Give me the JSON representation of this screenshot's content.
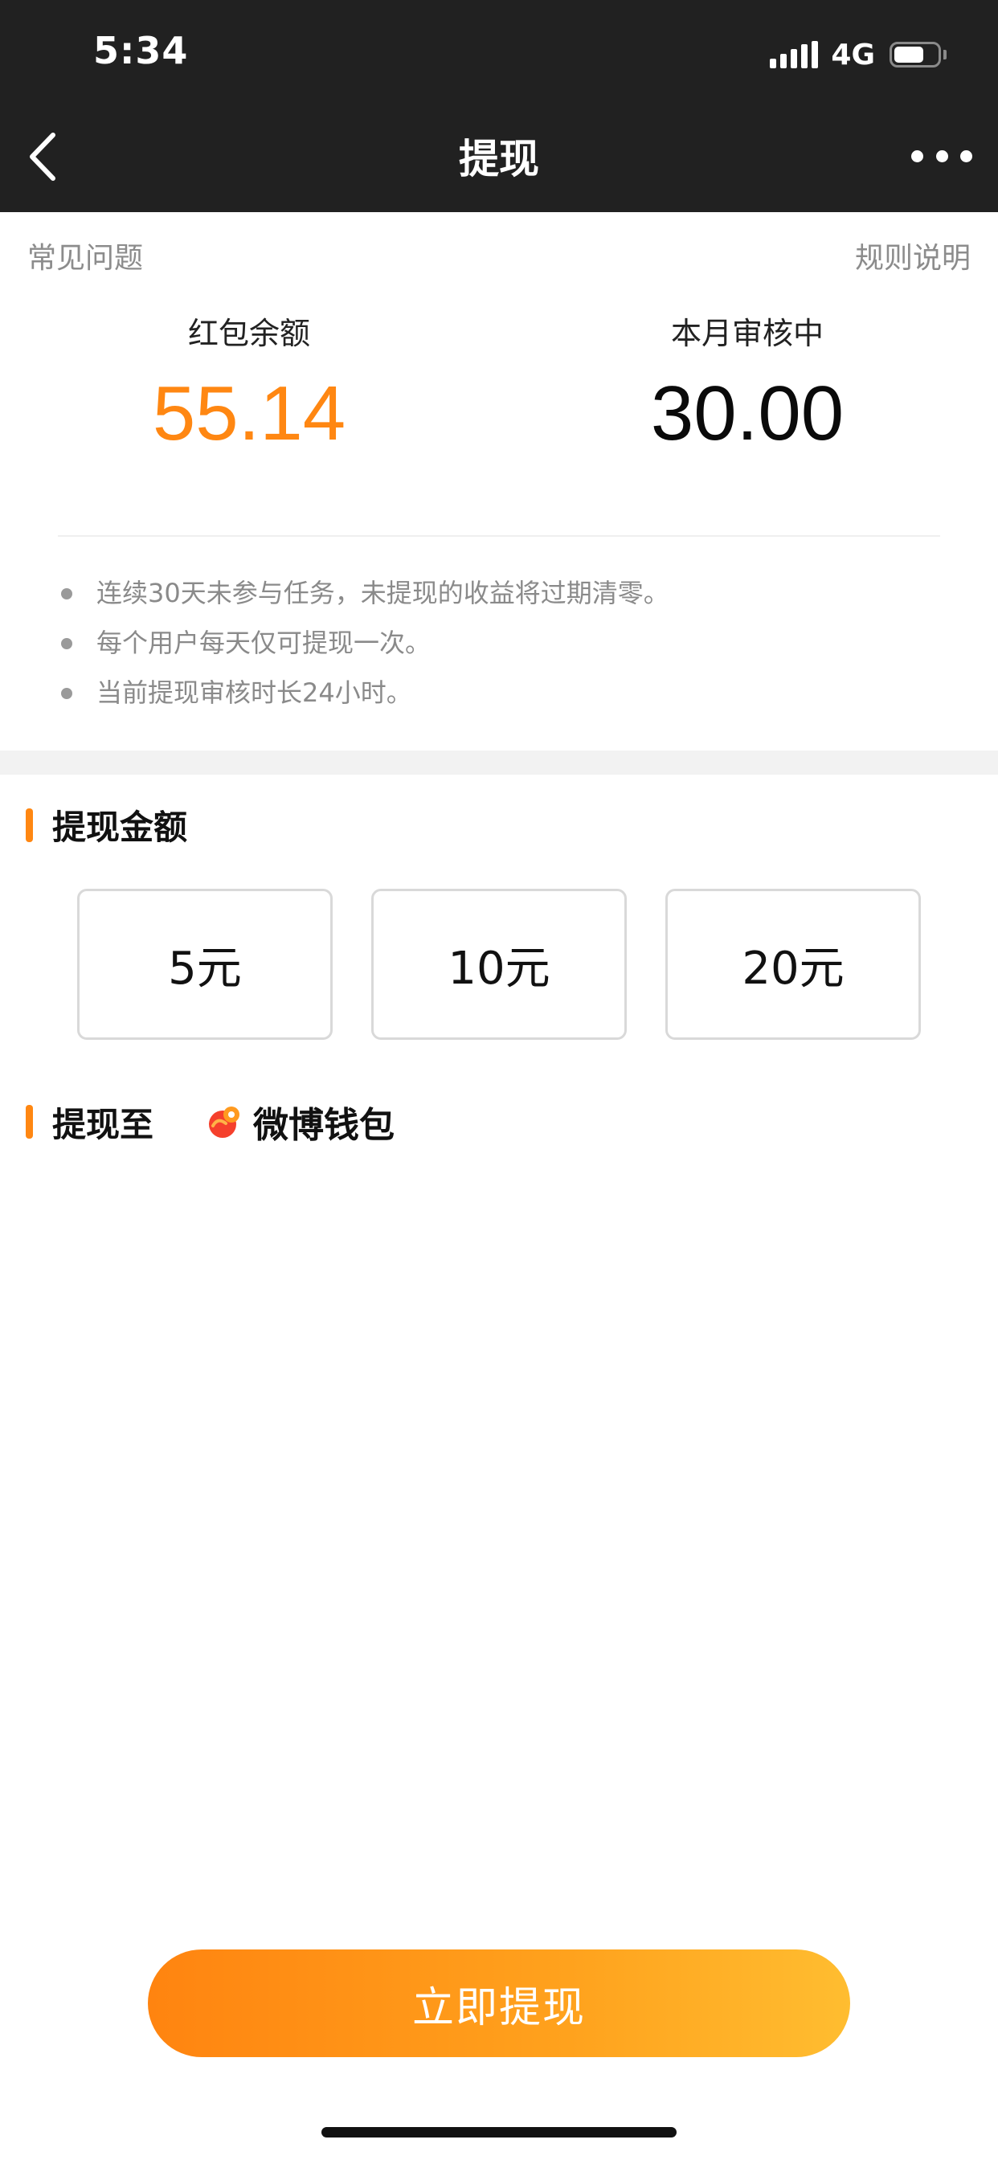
{
  "status_bar": {
    "time": "5:34",
    "network": "4G",
    "battery_level": 0.7,
    "signal-icon": "signal-bars-icon",
    "battery-icon": "battery-icon"
  },
  "nav": {
    "title": "提现",
    "back_icon": "chevron-left-icon",
    "more_icon": "more-dots-icon"
  },
  "card": {
    "faq_link": "常见问题",
    "rules_link": "规则说明",
    "balance_label": "红包余额",
    "balance_value": "55.14",
    "pending_label": "本月审核中",
    "pending_value": "30.00",
    "notes": [
      "连续30天未参与任务，未提现的收益将过期清零。",
      "每个用户每天仅可提现一次。",
      "当前提现审核时长24小时。"
    ]
  },
  "amount_section": {
    "title": "提现金额",
    "options": [
      "5元",
      "10元",
      "20元"
    ]
  },
  "destination_section": {
    "title": "提现至",
    "wallet_label": "微博钱包",
    "wallet_icon": "weibo-wallet-icon"
  },
  "submit_label": "立即提现",
  "colors": {
    "accent": "#ff8712",
    "header_bg": "#212121",
    "button_gradient_start": "#ff8410",
    "button_gradient_end": "#ffbd30"
  }
}
